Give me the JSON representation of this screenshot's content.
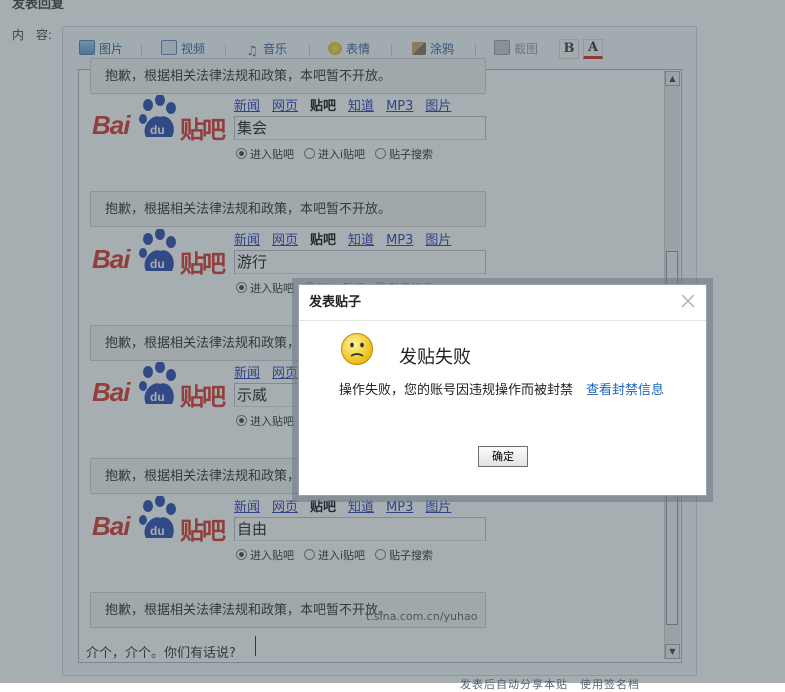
{
  "section": {
    "title": "发表回复",
    "content_label": "内　容:"
  },
  "toolbar": {
    "image": "图片",
    "video": "视频",
    "music": "音乐",
    "emoticon": "表情",
    "doodle": "涂鸦",
    "screenshot": "截图",
    "bold": "B",
    "font_color": "A"
  },
  "blocks": [
    {
      "notice": "抱歉，根据相关法律法规和政策，本吧暂不开放。",
      "keyword": "集会"
    },
    {
      "notice": "抱歉，根据相关法律法规和政策，本吧暂不开放。",
      "keyword": "游行"
    },
    {
      "notice": "抱歉，根据相关法律法规和政策，本吧暂不开放。",
      "keyword": "示威"
    },
    {
      "notice": "抱歉，根据相关法律法规和政策，本吧暂不开放。",
      "keyword": "自由"
    },
    {
      "notice": "抱歉，根据相关法律法规和政策，本吧暂不开放。"
    }
  ],
  "baidu": {
    "logo_bai": "Bai",
    "logo_du": "du",
    "logo_tieba": "贴吧",
    "nav": [
      "新闻",
      "网页",
      "贴吧",
      "知道",
      "MP3",
      "图片"
    ],
    "radios": [
      "进入贴吧",
      "进入i贴吧",
      "贴子搜索"
    ]
  },
  "watermark": "t.sina.com.cn/yuhao",
  "editor": {
    "typed_text": "介个，介个。你们有话说?"
  },
  "dialog": {
    "title": "发表贴子",
    "heading": "发贴失败",
    "message": "操作失败，您的账号因违规操作而被封禁",
    "link": "查看封禁信息",
    "ok_label": "确定"
  },
  "footer_faded": "发表后自动分享本贴　使用签名档"
}
